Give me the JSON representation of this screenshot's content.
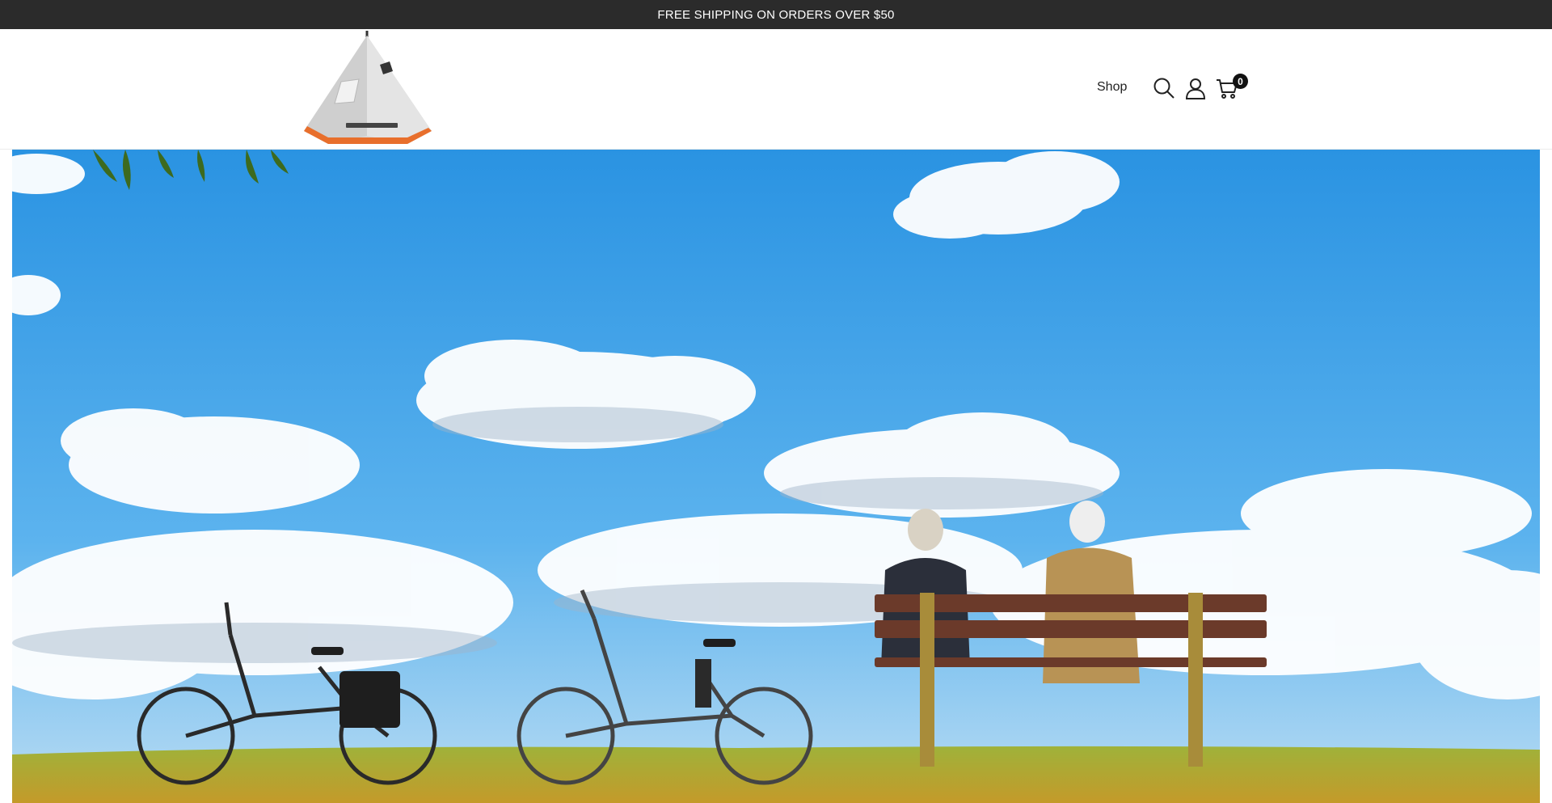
{
  "announcement": {
    "text": "FREE SHIPPING ON ORDERS OVER $50"
  },
  "header": {
    "logo_icon": "tent-logo",
    "nav": {
      "shop_label": "Shop"
    },
    "icons": {
      "search": "search-icon",
      "account": "user-icon",
      "cart": "cart-icon"
    },
    "cart_count": "0"
  },
  "hero": {
    "image": "seniors-on-bench-with-bicycles",
    "colors": {
      "sky": "#3aa0e6",
      "grass": "#8fa22c"
    }
  }
}
